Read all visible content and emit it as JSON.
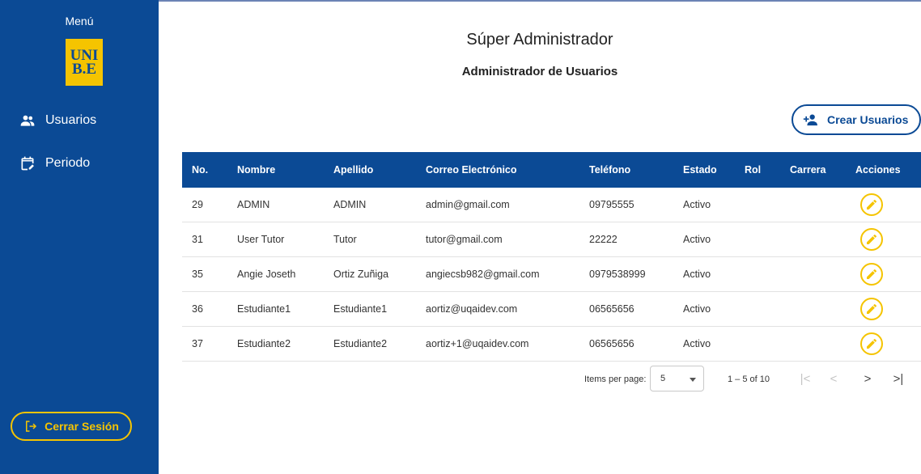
{
  "sidebar": {
    "menu_title": "Menú",
    "logo_lines": [
      "UNI",
      "B.E"
    ],
    "items": [
      {
        "label": "Usuarios",
        "icon": "users-icon"
      },
      {
        "label": "Periodo",
        "icon": "calendar-edit-icon"
      }
    ],
    "logout_label": "Cerrar Sesión"
  },
  "header": {
    "title": "Súper Administrador",
    "subtitle": "Administrador de Usuarios"
  },
  "create_button_label": "Crear Usuarios",
  "table": {
    "columns": [
      "No.",
      "Nombre",
      "Apellido",
      "Correo Electrónico",
      "Teléfono",
      "Estado",
      "Rol",
      "Carrera",
      "Acciones"
    ],
    "rows": [
      {
        "no": "29",
        "nombre": "ADMIN",
        "apellido": "ADMIN",
        "correo": "admin@gmail.com",
        "telefono": "09795555",
        "estado": "Activo",
        "rol": "",
        "carrera": ""
      },
      {
        "no": "31",
        "nombre": "User Tutor",
        "apellido": "Tutor",
        "correo": "tutor@gmail.com",
        "telefono": "22222",
        "estado": "Activo",
        "rol": "",
        "carrera": ""
      },
      {
        "no": "35",
        "nombre": "Angie Joseth",
        "apellido": "Ortiz Zuñiga",
        "correo": "angiecsb982@gmail.com",
        "telefono": "0979538999",
        "estado": "Activo",
        "rol": "",
        "carrera": ""
      },
      {
        "no": "36",
        "nombre": "Estudiante1",
        "apellido": "Estudiante1",
        "correo": "aortiz@uqaidev.com",
        "telefono": "06565656",
        "estado": "Activo",
        "rol": "",
        "carrera": ""
      },
      {
        "no": "37",
        "nombre": "Estudiante2",
        "apellido": "Estudiante2",
        "correo": "aortiz+1@uqaidev.com",
        "telefono": "06565656",
        "estado": "Activo",
        "rol": "",
        "carrera": ""
      }
    ]
  },
  "paginator": {
    "items_per_page_label": "Items per page:",
    "page_size": "5",
    "range_label": "1 – 5 of 10",
    "first": "|<",
    "prev": "<",
    "next": ">",
    "last": ">|"
  },
  "colors": {
    "primary": "#0b4a95",
    "accent": "#f5c400"
  }
}
